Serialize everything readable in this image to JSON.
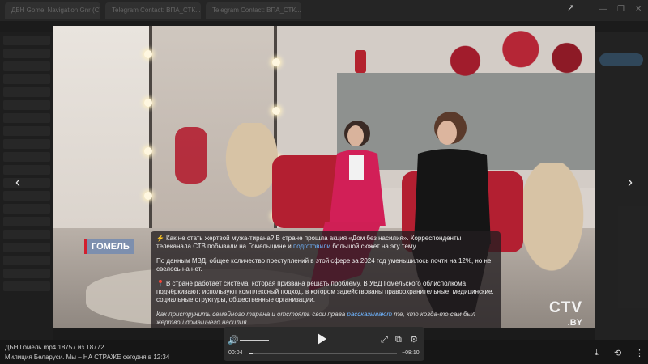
{
  "browser": {
    "tabs": [
      "ДБН Gomel Navigation Gnr (CV...",
      "Telegram Contact: ВПА_СТК...",
      "Telegram Contact: ВПА_СТК..."
    ]
  },
  "video": {
    "region_badge": "ГОМЕЛЬ",
    "logo_main": "CTV",
    "logo_sub": ".BY"
  },
  "caption": {
    "p1_prefix": "Как не стать жертвой мужа-тирана? В стране прошла акция «Дом без насилия». Корреспонденты телеканала СТВ побывали на Гомельщине и ",
    "p1_link": "подготовили",
    "p1_suffix": " большой сюжет на эту тему",
    "p2": "По данным МВД, общее количество преступлений в этой сфере за 2024 год уменьшилось почти на 12%, но не свелось на нет.",
    "p3": "В стране работает система, которая призвана решать проблему. В УВД Гомельского облисполкома подчёркивают: используют комплексный подход, в котором задействованы правоохранительные, медицинские, социальные структуры, общественные организации.",
    "p4_prefix": "Как приструнить семейного тирана и отстоять свои права ",
    "p4_link": "рассказывают",
    "p4_suffix": " те, кто когда-то сам был жертвой домашнего насилия.",
    "p5": "..."
  },
  "player": {
    "time_current": "00:04",
    "time_total": "−08:10",
    "progress": 0.01
  },
  "file_info": {
    "line1": "ДБН Гомель.mp4 18757 из 18772",
    "line2": "Милиция Беларуси. Мы – НА СТРАЖЕ   сегодня в 12:34"
  },
  "icons": {
    "nav_left": "chevron-left-icon",
    "nav_right": "chevron-right-icon",
    "volume": "volume-icon",
    "play": "play-icon",
    "fullscreen": "fullscreen-icon",
    "pip": "picture-in-picture-icon",
    "settings": "gear-icon",
    "download": "download-icon",
    "rotate": "rotate-icon",
    "more": "more-icon"
  }
}
